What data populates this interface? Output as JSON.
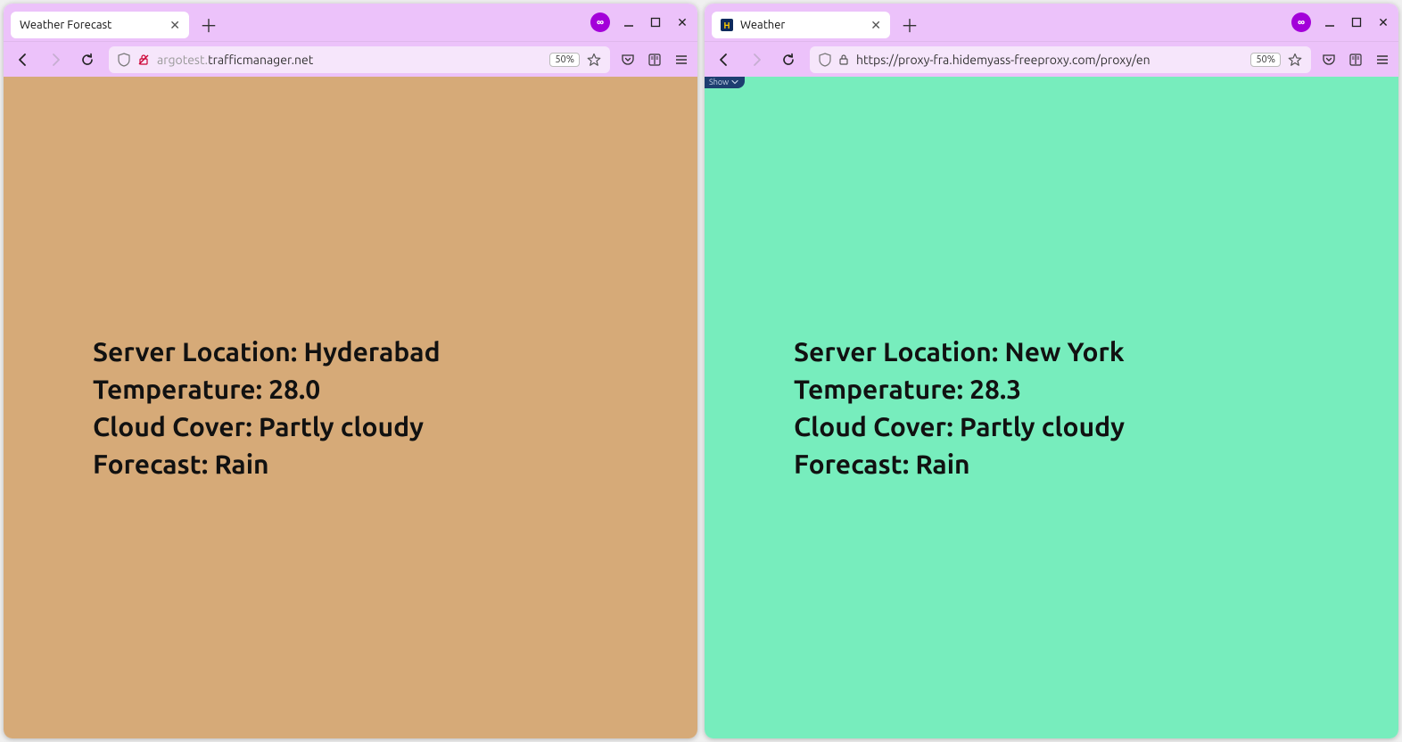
{
  "windows": [
    {
      "tab_title": "Weather Forecast",
      "has_favicon": false,
      "url_display": "argotest.trafficmanager.net",
      "url_host_dimmed": "argotest.",
      "url_host_rest": "trafficmanager.net",
      "insecure": true,
      "zoom": "50%",
      "bg_class": "hyd",
      "show_overlay": false,
      "lines": {
        "loc_label": "Server Location: ",
        "loc_value": "Hyderabad",
        "temp_label": "Temperature: ",
        "temp_value": "28.0",
        "cloud_label": "Cloud Cover: ",
        "cloud_value": "Partly cloudy",
        "fc_label": "Forecast: ",
        "fc_value": "Rain"
      }
    },
    {
      "tab_title": "Weather",
      "has_favicon": true,
      "url_display": "https://proxy-fra.hidemyass-freeproxy.com/proxy/en",
      "insecure": false,
      "zoom": "50%",
      "bg_class": "ny",
      "show_overlay": true,
      "overlay_label": "Show",
      "lines": {
        "loc_label": "Server Location: ",
        "loc_value": "New York",
        "temp_label": "Temperature: ",
        "temp_value": "28.3",
        "cloud_label": "Cloud Cover: ",
        "cloud_value": "Partly cloudy",
        "fc_label": "Forecast: ",
        "fc_value": "Rain"
      }
    }
  ],
  "ext_badge_glyph": "∞"
}
